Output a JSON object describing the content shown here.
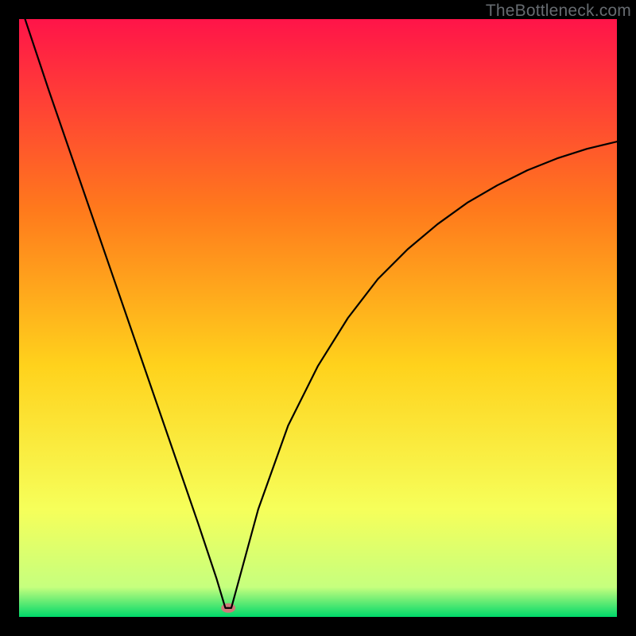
{
  "watermark": "TheBottleneck.com",
  "chart_data": {
    "type": "line",
    "title": "",
    "xlabel": "",
    "ylabel": "",
    "xlim": [
      0,
      100
    ],
    "ylim": [
      0,
      100
    ],
    "grid": false,
    "background_gradient": {
      "top": "#ff1449",
      "upper_mid": "#ff7a1c",
      "mid": "#ffd21c",
      "lower_mid": "#f6ff5a",
      "near_bottom": "#c6ff7e",
      "bottom": "#00d86a"
    },
    "series": [
      {
        "name": "bottleneck-curve",
        "color": "#000000",
        "x": [
          1,
          5,
          10,
          15,
          20,
          25,
          30,
          33,
          34.5,
          35.5,
          37,
          40,
          45,
          50,
          55,
          60,
          65,
          70,
          75,
          80,
          85,
          90,
          95,
          100
        ],
        "y": [
          100,
          88,
          73.5,
          59,
          44.5,
          30,
          15.5,
          6.5,
          1.5,
          1.5,
          7,
          18,
          32,
          42,
          50,
          56.5,
          61.5,
          65.7,
          69.3,
          72.2,
          74.7,
          76.7,
          78.3,
          79.5
        ]
      }
    ],
    "marker": {
      "name": "optimum-marker",
      "x": 35,
      "y": 1.5,
      "color": "#cf7a7a",
      "rx": 9,
      "ry": 6
    }
  }
}
